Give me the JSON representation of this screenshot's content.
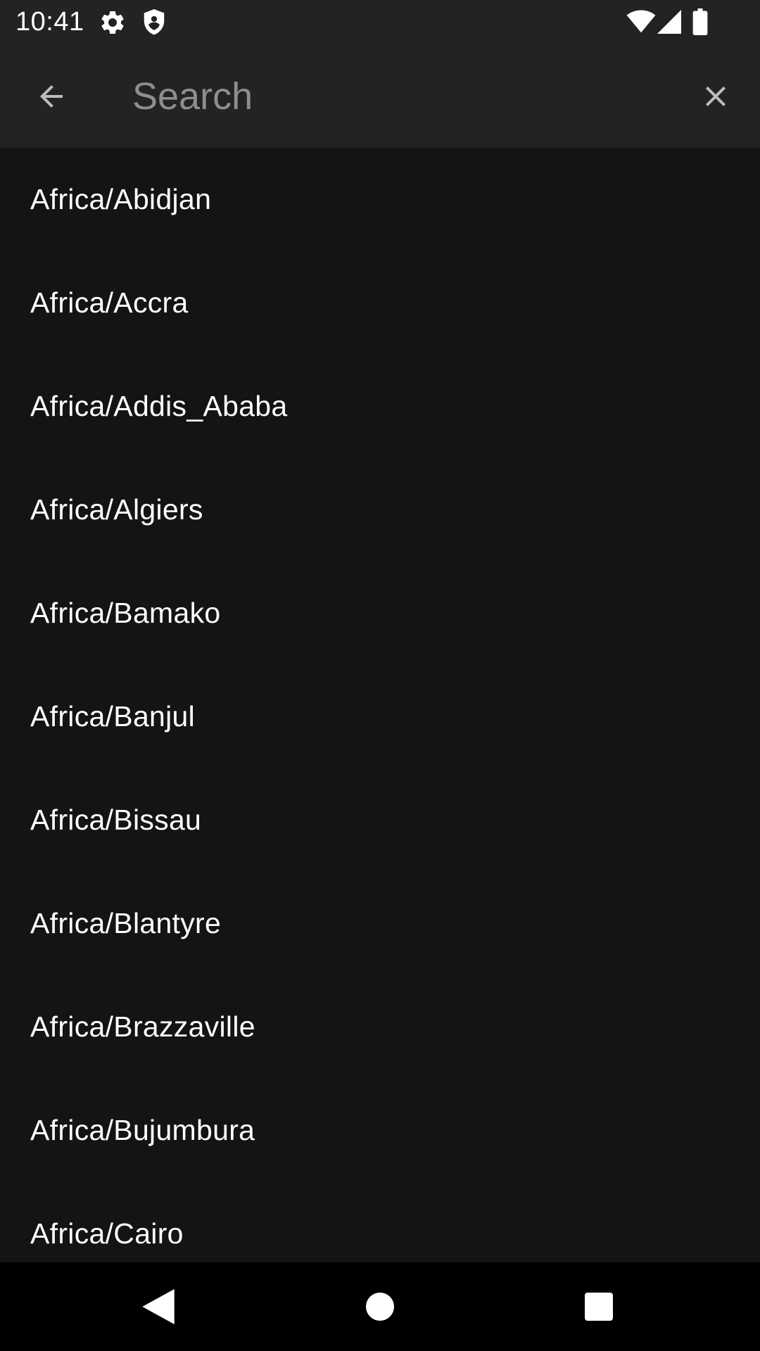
{
  "status_bar": {
    "time": "10:41",
    "icons": [
      "settings-gear-icon",
      "shield-icon",
      "wifi-icon",
      "cellular-signal-icon",
      "battery-icon"
    ]
  },
  "toolbar": {
    "back_icon": "arrow-back-icon",
    "search_placeholder": "Search",
    "search_value": "",
    "clear_icon": "close-icon"
  },
  "timezones": [
    "Africa/Abidjan",
    "Africa/Accra",
    "Africa/Addis_Ababa",
    "Africa/Algiers",
    "Africa/Bamako",
    "Africa/Banjul",
    "Africa/Bissau",
    "Africa/Blantyre",
    "Africa/Brazzaville",
    "Africa/Bujumbura",
    "Africa/Cairo"
  ],
  "nav_bar": {
    "icons": [
      "nav-back-icon",
      "nav-home-icon",
      "nav-recents-icon"
    ]
  },
  "colors": {
    "bar_background": "#232323",
    "list_background": "#141414",
    "text_primary": "#ffffff",
    "placeholder": "#8e8e8e",
    "nav_background": "#000000"
  }
}
